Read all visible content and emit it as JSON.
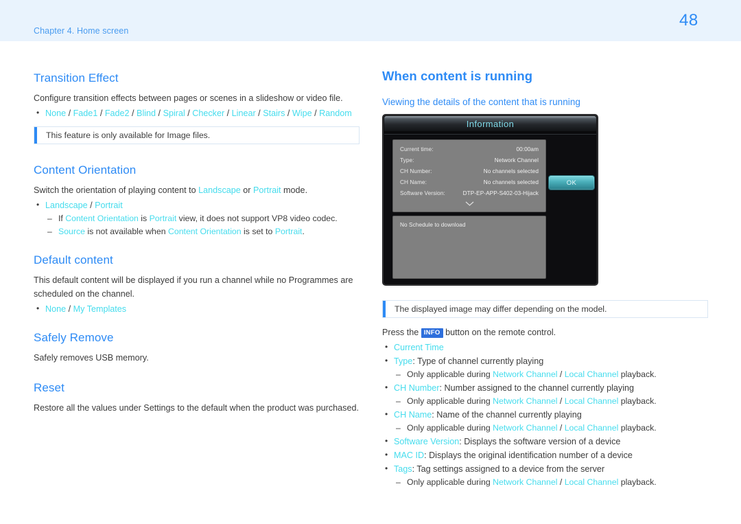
{
  "header": {
    "chapter": "Chapter 4. Home screen",
    "page_number": "48"
  },
  "colors": {
    "heading_blue": "#2e8bf5",
    "option_cyan": "#45dced",
    "header_band": "#e9f3fd",
    "note_bar": "#2e8bf5",
    "info_badge": "#2e6fdc"
  },
  "left_column": {
    "transition_effect": {
      "title": "Transition Effect",
      "description": "Configure transition effects between pages or scenes in a slideshow or video file.",
      "options": [
        "None",
        "Fade1",
        "Fade2",
        "Blind",
        "Spiral",
        "Checker",
        "Linear",
        "Stairs",
        "Wipe",
        "Random"
      ],
      "note": "This feature is only available for Image files."
    },
    "content_orientation": {
      "title": "Content Orientation",
      "desc_part1": "Switch the orientation of playing content to ",
      "desc_opt1": "Landscape",
      "desc_mid": " or ",
      "desc_opt2": "Portrait",
      "desc_part2": " mode.",
      "options": [
        "Landscape",
        "Portrait"
      ],
      "notes": [
        {
          "p1": "If ",
          "t1": "Content Orientation",
          "p2": " is ",
          "t2": "Portrait",
          "p3": " view, it does not support VP8 video codec."
        },
        {
          "p1": "",
          "t1": "Source",
          "p2": " is not available when ",
          "t2": "Content Orientation",
          "p3": " is set to ",
          "t3": "Portrait",
          "p4": "."
        }
      ]
    },
    "default_content": {
      "title": "Default content",
      "description": "This default content will be displayed if you run a channel while no Programmes are scheduled on the channel.",
      "options": [
        "None",
        "My Templates"
      ]
    },
    "safely_remove": {
      "title": "Safely Remove",
      "description": "Safely removes USB memory."
    },
    "reset": {
      "title": "Reset",
      "description": "Restore all the values under Settings to the default when the product was purchased."
    }
  },
  "right_column": {
    "title": "When content is running",
    "subtitle": "Viewing the details of the content that is running",
    "device_screenshot": {
      "window_title": "Information",
      "rows": [
        {
          "label": "Current time:",
          "value": "00:00am"
        },
        {
          "label": "Type:",
          "value": "Network Channel"
        },
        {
          "label": "CH Number:",
          "value": "No channels selected"
        },
        {
          "label": "CH Name:",
          "value": "No channels selected"
        },
        {
          "label": "Software Version:",
          "value": "DTP-EP-APP-S402-03-Hijack"
        }
      ],
      "expand_icon": "chevron-down-icon",
      "schedule_text": "No Schedule to download",
      "ok_button": "OK"
    },
    "note": "The displayed image may differ depending on the model.",
    "press_line": {
      "before": "Press the ",
      "badge": "INFO",
      "after": " button on the remote control."
    },
    "details": [
      {
        "term": "Current Time",
        "desc": "",
        "sub": null
      },
      {
        "term": "Type",
        "desc": ": Type of channel currently playing",
        "sub": {
          "p1": "Only applicable during ",
          "t1": "Network Channel",
          "p2": " / ",
          "t2": "Local Channel",
          "p3": " playback."
        }
      },
      {
        "term": "CH Number",
        "desc": ": Number assigned to the channel currently playing",
        "sub": {
          "p1": "Only applicable during ",
          "t1": "Network Channel",
          "p2": " / ",
          "t2": "Local Channel",
          "p3": " playback."
        }
      },
      {
        "term": "CH Name",
        "desc": ": Name of the channel currently playing",
        "sub": {
          "p1": "Only applicable during ",
          "t1": "Network Channel",
          "p2": " / ",
          "t2": "Local Channel",
          "p3": " playback."
        }
      },
      {
        "term": "Software Version",
        "desc": ": Displays the software version of a device",
        "sub": null
      },
      {
        "term": "MAC ID",
        "desc": ": Displays the original identification number of a device",
        "sub": null
      },
      {
        "term": "Tags",
        "desc": ": Tag settings assigned to a device from the server",
        "sub": {
          "p1": "Only applicable during ",
          "t1": "Network Channel",
          "p2": " / ",
          "t2": "Local Channel",
          "p3": " playback."
        }
      }
    ]
  }
}
